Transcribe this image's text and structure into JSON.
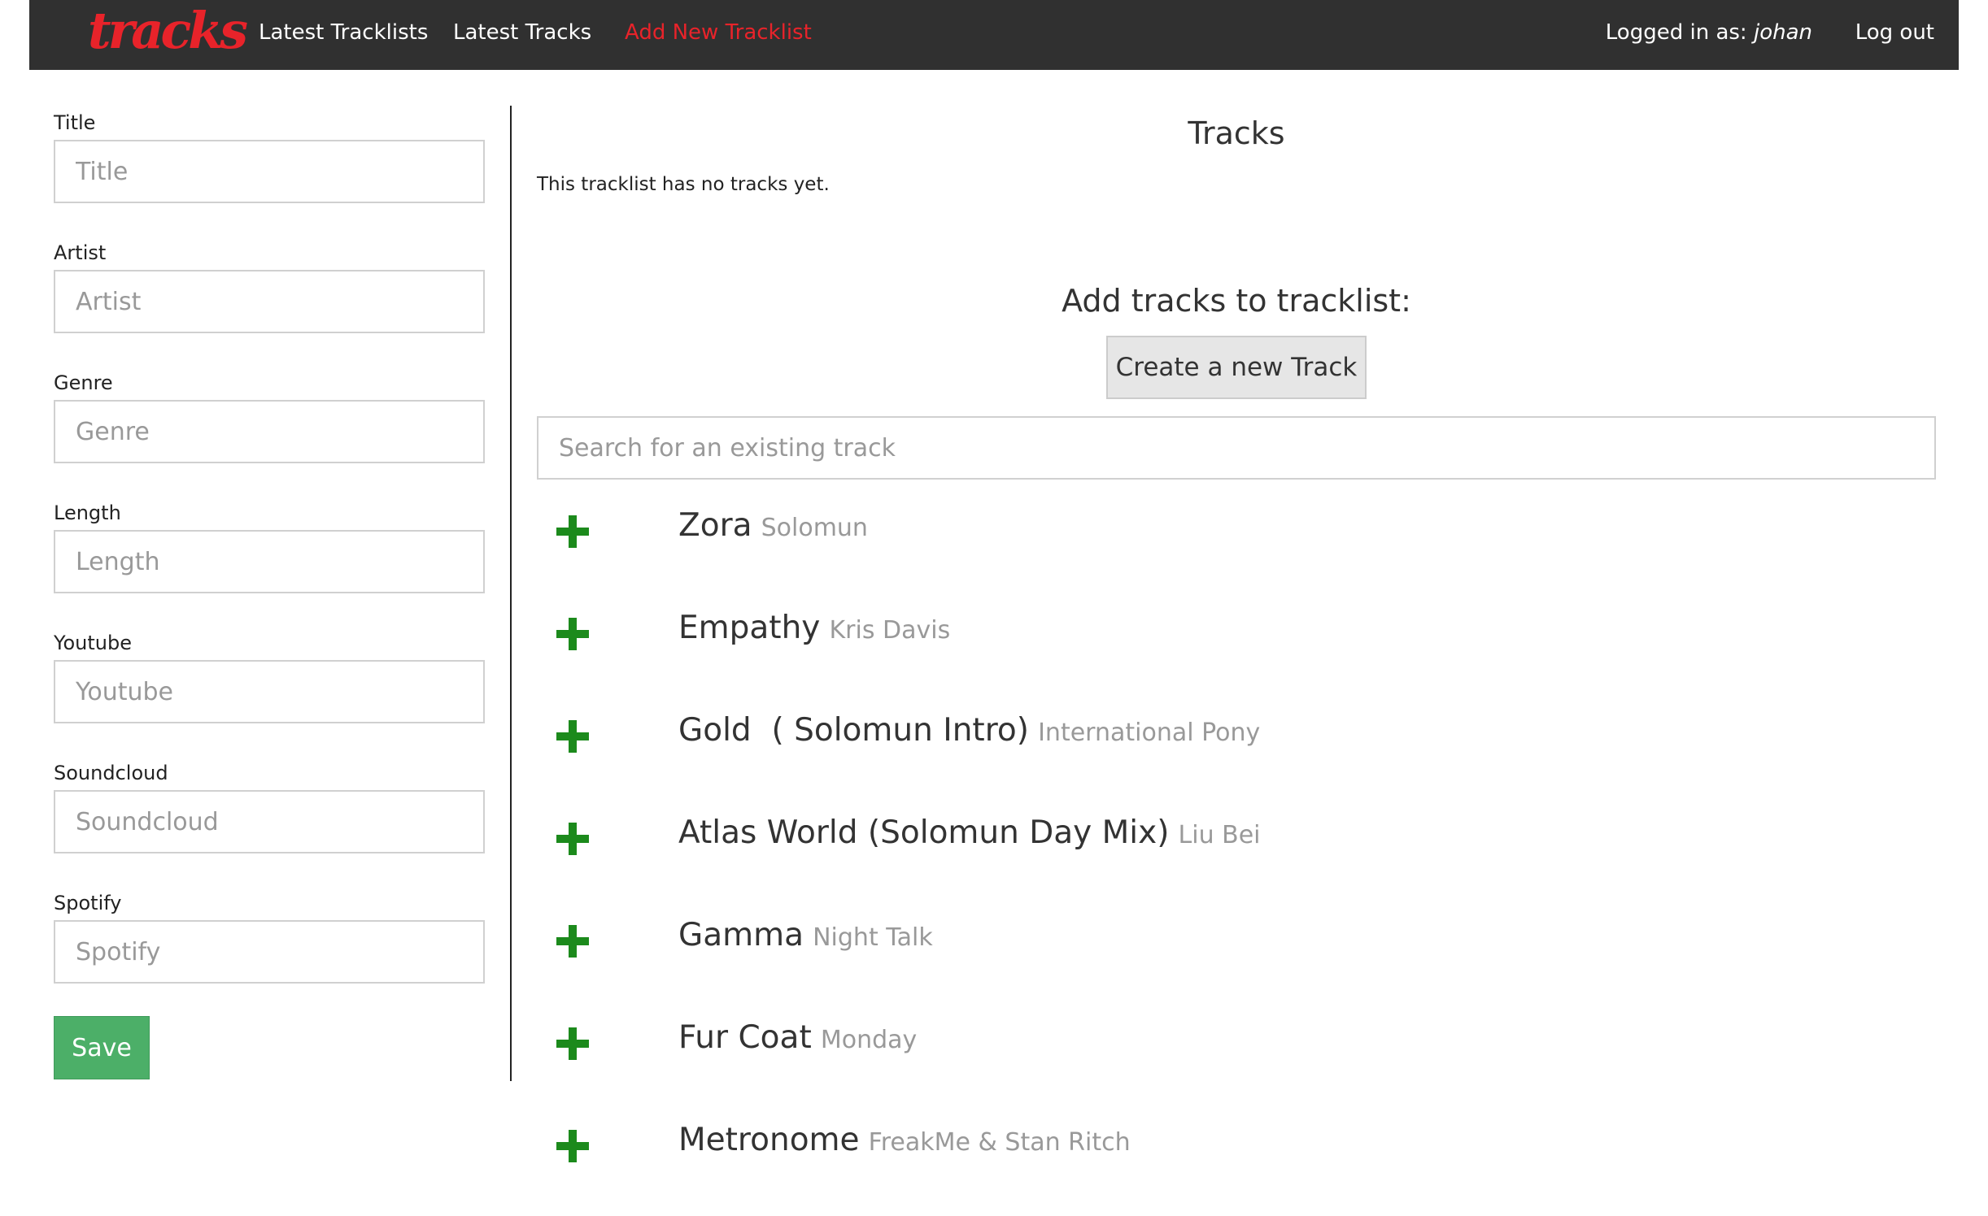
{
  "navbar": {
    "logo_text": "tracks",
    "links": [
      "Latest Tracklists",
      "Latest Tracks",
      "Add New Tracklist"
    ],
    "logged_in_prefix": "Logged in as:",
    "username": "johan",
    "logout_label": "Log out",
    "active_color": "#e8232a",
    "background_color": "#303030"
  },
  "form": {
    "fields": [
      {
        "label": "Title",
        "placeholder": "Title"
      },
      {
        "label": "Artist",
        "placeholder": "Artist"
      },
      {
        "label": "Genre",
        "placeholder": "Genre"
      },
      {
        "label": "Length",
        "placeholder": "Length"
      },
      {
        "label": "Youtube",
        "placeholder": "Youtube"
      },
      {
        "label": "Soundcloud",
        "placeholder": "Soundcloud"
      },
      {
        "label": "Spotify",
        "placeholder": "Spotify"
      }
    ],
    "save_label": "Save",
    "save_color": "#4caf68"
  },
  "tracks_panel": {
    "title": "Tracks",
    "empty_message": "This tracklist has no tracks yet.",
    "add_title": "Add tracks to tracklist:",
    "create_button_label": "Create a new Track",
    "search_placeholder": "Search for an existing track",
    "add_icon": "plus-icon",
    "add_icon_color": "#1c8a1c",
    "results": [
      {
        "title": "Zora",
        "artist": "Solomun"
      },
      {
        "title": "Empathy",
        "artist": "Kris Davis"
      },
      {
        "title": "Gold  ( Solomun Intro)",
        "artist": "International Pony"
      },
      {
        "title": "Atlas World (Solomun Day Mix)",
        "artist": "Liu Bei"
      },
      {
        "title": "Gamma",
        "artist": "Night Talk"
      },
      {
        "title": "Fur Coat",
        "artist": "Monday"
      },
      {
        "title": "Metronome",
        "artist": "FreakMe & Stan Ritch"
      }
    ]
  }
}
